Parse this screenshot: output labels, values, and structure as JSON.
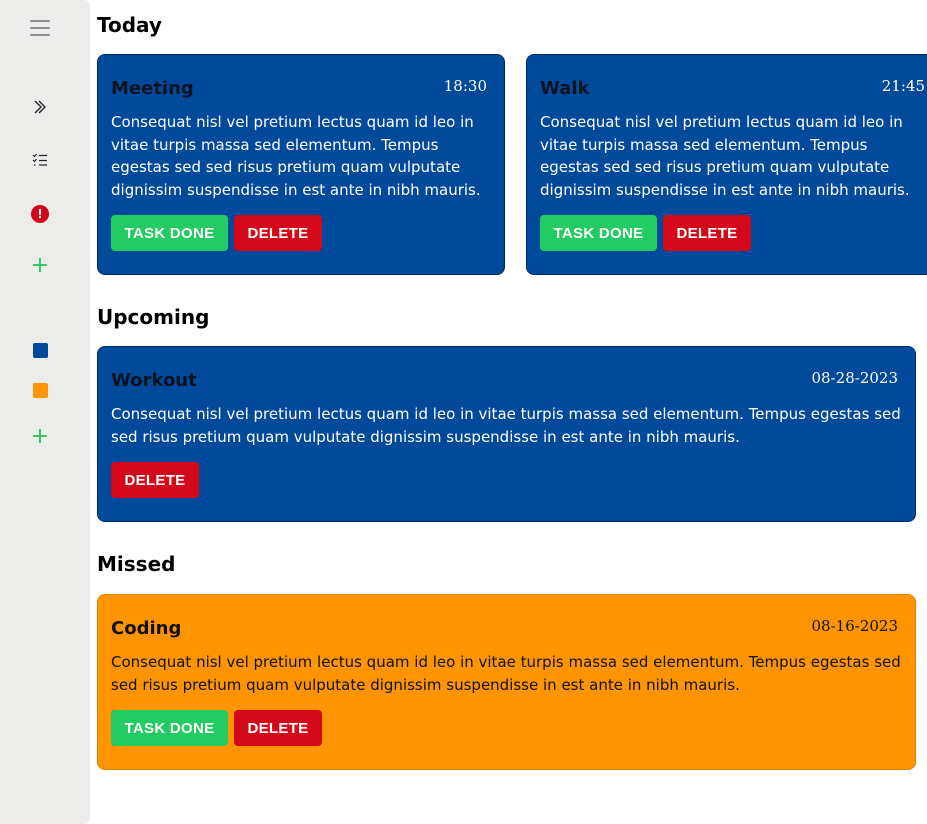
{
  "sidebar": {
    "menu_icon": "hamburger-menu-icon",
    "expand_icon": "double-chevron-right-icon",
    "tasks_icon": "checklist-icon",
    "alert_icon": "exclamation-circle-icon",
    "alert_glyph": "!",
    "add_icon": "plus-icon",
    "plus_glyph": "+",
    "categories": [
      {
        "color": "#01499b",
        "icon": "color-swatch-icon"
      },
      {
        "color": "#fd9400",
        "icon": "color-swatch-icon"
      }
    ]
  },
  "sections": {
    "today": "Today",
    "upcoming": "Upcoming",
    "missed": "Missed"
  },
  "tasks": {
    "meeting": {
      "title": "Meeting",
      "time": "18:30",
      "body": "Consequat nisl vel pretium lectus quam id leo in vitae turpis massa sed elementum. Tempus egestas sed sed risus pretium quam vulputate dignissim suspendisse in est ante in nibh mauris."
    },
    "walk": {
      "title": "Walk",
      "time": "21:45",
      "body": "Consequat nisl vel pretium lectus quam id leo in vitae turpis massa sed elementum. Tempus egestas sed sed risus pretium quam vulputate dignissim suspendisse in est ante in nibh mauris."
    },
    "workout": {
      "title": "Workout",
      "date": "08-28-2023",
      "body": "Consequat nisl vel pretium lectus quam id leo in vitae turpis massa sed elementum. Tempus egestas sed sed risus pretium quam vulputate dignissim suspendisse in est ante in nibh mauris."
    },
    "coding": {
      "title": "Coding",
      "date": "08-16-2023",
      "body": "Consequat nisl vel pretium lectus quam id leo in vitae turpis massa sed elementum. Tempus egestas sed sed risus pretium quam vulputate dignissim suspendisse in est ante in nibh mauris."
    }
  },
  "buttons": {
    "done": "TASK DONE",
    "delete": "DELETE"
  },
  "colors": {
    "card_blue": "#01499b",
    "card_orange": "#fd9400",
    "done_green": "#22cc62",
    "delete_red": "#d3091a"
  }
}
